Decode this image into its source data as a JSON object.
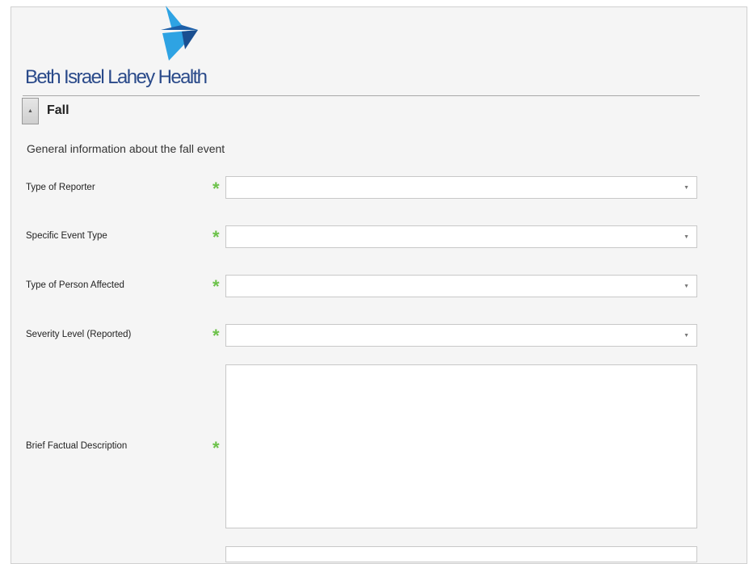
{
  "brand": {
    "name": "Beth Israel Lahey Health",
    "logo_icon": "bird-logo-icon",
    "colors": {
      "logo_dark": "#1c5fa8",
      "logo_light": "#2ea3e3",
      "text": "#2a4a8a"
    }
  },
  "section": {
    "toggle_icon": "collapse-up-icon",
    "toggle_glyph": "▲",
    "title": "Fall",
    "subtitle": "General information about the fall event"
  },
  "required_marker": "*",
  "required_color": "#6cc24a",
  "fields": [
    {
      "label": "Type of Reporter",
      "value": "",
      "caret": "▼"
    },
    {
      "label": "Specific Event Type",
      "value": "",
      "caret": "▼"
    },
    {
      "label": "Type of Person Affected",
      "value": "",
      "caret": "▼"
    },
    {
      "label": "Severity Level (Reported)",
      "value": "",
      "caret": "▼"
    }
  ],
  "description": {
    "label": "Brief Factual Description",
    "value": ""
  }
}
